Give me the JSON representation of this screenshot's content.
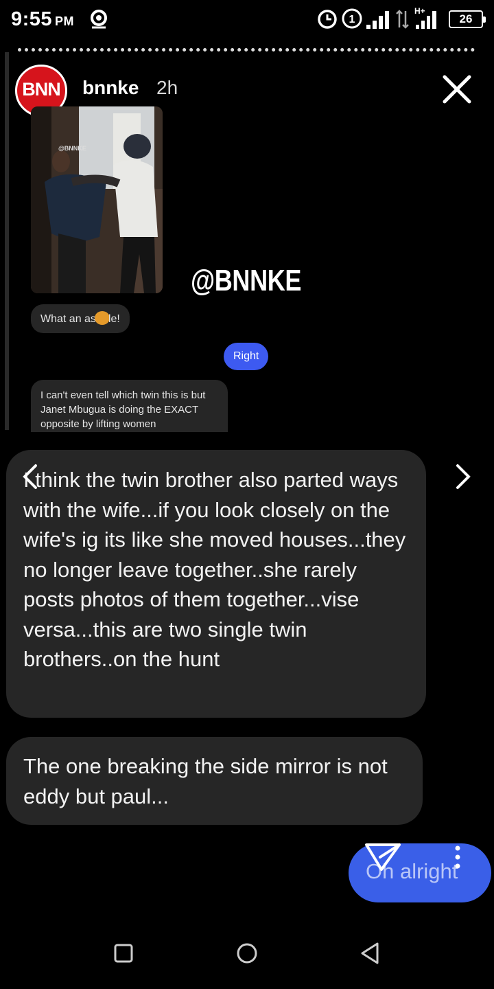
{
  "status_bar": {
    "time": "9:55",
    "ampm": "PM",
    "battery": "26"
  },
  "story": {
    "avatar_text": "BNN",
    "username": "bnnke",
    "time_ago": "2h",
    "watermark": "@BNNKE",
    "thumbnail_watermark": "@BNNKE"
  },
  "embedded_chat": {
    "reply_a_before": "What an as",
    "reply_a_after": "le!",
    "reply_b": "Right",
    "reply_c": "I can't even tell which twin this is but Janet Mbugua is doing the EXACT opposite by lifting women"
  },
  "replies": {
    "main": "I think the twin  brother also parted ways with the wife...if you look closely on the wife's ig its like she moved houses...they no longer leave together..she rarely posts photos of them together...vise versa...this are two single twin brothers..on the hunt",
    "second": "The one breaking the side mirror is not eddy but paul...",
    "sent": "Oh alright"
  },
  "icons": {
    "status": [
      "location-icon",
      "alarm-icon",
      "sim-icon",
      "signal-icon",
      "data-icon",
      "signal-hplus-icon"
    ],
    "close": "close-icon",
    "nav": [
      "chevron-left-icon",
      "chevron-right-icon"
    ],
    "send": "send-icon",
    "more": "more-vertical-icon",
    "system_nav": [
      "recents-icon",
      "home-icon",
      "back-icon"
    ]
  },
  "colors": {
    "brand_red": "#d6141c",
    "bubble_gray": "#262626",
    "accent_blue": "#3a5fe8",
    "right_bubble_blue": "#3d5af1"
  }
}
